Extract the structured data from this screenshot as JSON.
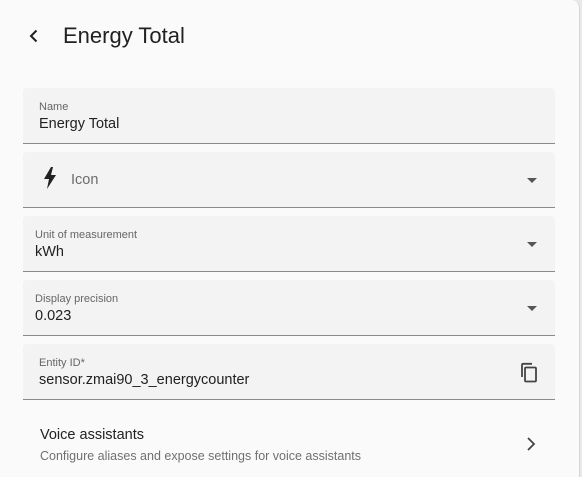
{
  "header": {
    "title": "Energy Total",
    "back_icon": "chevron-left-icon"
  },
  "fields": {
    "name": {
      "label": "Name",
      "value": "Energy Total"
    },
    "icon": {
      "placeholder": "Icon",
      "icon": "lightning-bolt-icon"
    },
    "unit": {
      "label": "Unit of measurement",
      "value": "kWh"
    },
    "precision": {
      "label": "Display precision",
      "value": "0.023"
    },
    "entity_id": {
      "label": "Entity ID*",
      "value": "sensor.zmai90_3_energycounter",
      "icon": "copy-icon"
    }
  },
  "voice_assistants": {
    "title": "Voice assistants",
    "subtitle": "Configure aliases and expose settings for voice assistants"
  }
}
